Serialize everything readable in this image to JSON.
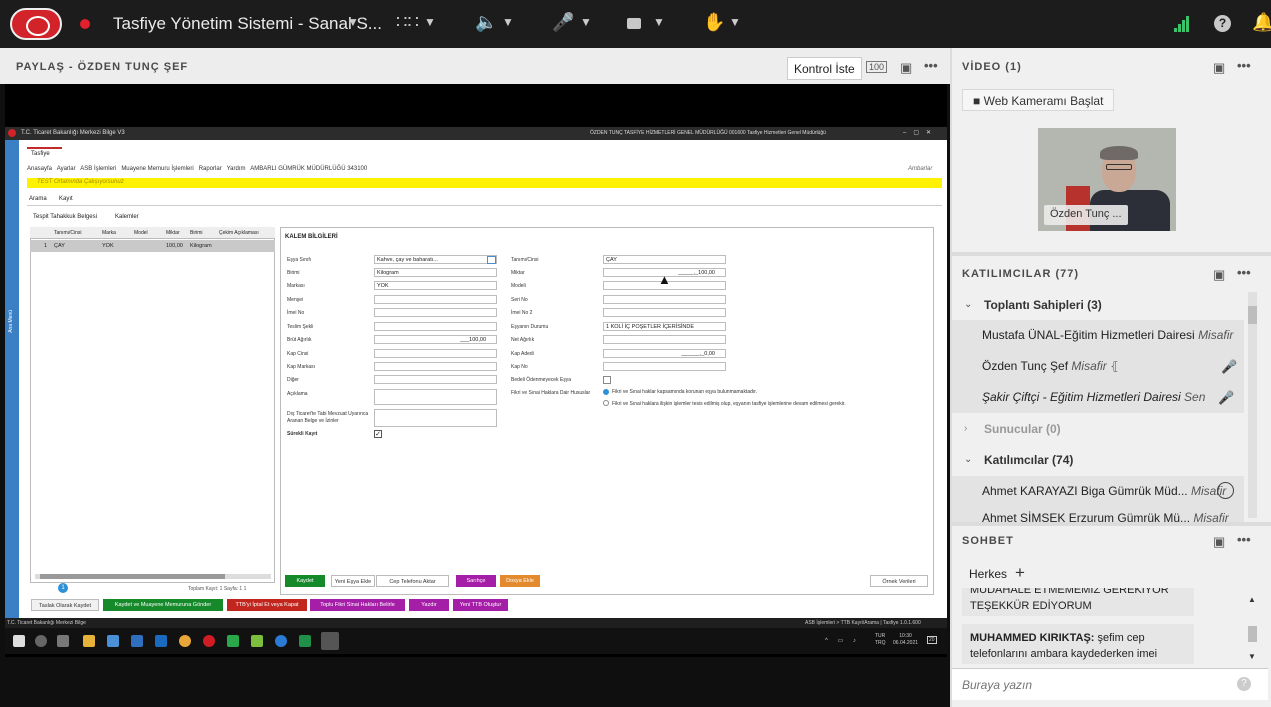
{
  "topbar": {
    "title": "Tasfiye Yönetim Sistemi - Sanal S..."
  },
  "share": {
    "label": "PAYLAŞ  - ÖZDEN TUNÇ ŞEF",
    "control_button": "Kontrol İste",
    "zoom_icon_label": "100"
  },
  "app": {
    "title": "T.C. Ticaret Bakanlığı   Merkezi Bilge V3",
    "title_right": "ÖZDEN TUNÇ   TASFİYE HİZMETLERİ GENEL MÜDÜRLÜĞÜ 001600   Tasfiye Hizmetleri Genel Müdürlüğü",
    "tab": "Tasfiye",
    "menu": [
      "Anasayfa",
      "Ayarlar",
      "ASB İşlemleri",
      "Muayene Memuru İşlemleri",
      "Raporlar",
      "Yardım",
      "AMBARLI GÜMRÜK MÜDÜRLÜĞÜ 343100"
    ],
    "menu_right": "Ambarlar",
    "warning": "TEST Ortamında Çalışıyorsunuz",
    "subtabs": [
      "Arama",
      "Kayıt"
    ],
    "subtabs2": [
      "Tespit Tahakkuk Belgesi",
      "Kalemler"
    ],
    "left_strip": "Ana Menü",
    "grid": {
      "headers": [
        "Tanımı/Cinsi",
        "Marka",
        "Model",
        "Miktar",
        "Birimi",
        "Çekim Açıklaması"
      ],
      "row": [
        "1",
        "ÇAY",
        "YOK",
        "",
        "100,00",
        "Kilogram",
        ""
      ]
    },
    "pager": {
      "page": "1",
      "info": "Toplam Kayıt:  1    Sayfa:  1   1"
    },
    "section_title": "KALEM BİLGİLERİ",
    "form_left": [
      {
        "label": "Eşya Sınıfı",
        "value": "Kahve, çay ve baharatı..."
      },
      {
        "label": "Birimi",
        "value": "Kilogram"
      },
      {
        "label": "Markası",
        "value": "YOK"
      },
      {
        "label": "Menşei",
        "value": ""
      },
      {
        "label": "İmei No",
        "value": ""
      },
      {
        "label": "Teslim Şekli",
        "value": ""
      },
      {
        "label": "Brüt Ağırlık",
        "value": "___100,00"
      },
      {
        "label": "Kap Cinsi",
        "value": ""
      },
      {
        "label": "Kap Markası",
        "value": ""
      },
      {
        "label": "Diğer",
        "value": ""
      },
      {
        "label": "Açıklama",
        "value": ""
      },
      {
        "label": "Dış Ticaret'te Tabi Mevzuat Uyarınca Aranan Belge ve İzinler",
        "value": ""
      }
    ],
    "form_right": [
      {
        "label": "Tanımı/Cinsi",
        "value": "ÇAY"
      },
      {
        "label": "Miktar",
        "value": "_____,_100,00"
      },
      {
        "label": "Modeli",
        "value": ""
      },
      {
        "label": "Seri No",
        "value": ""
      },
      {
        "label": "İmei No 2",
        "value": ""
      },
      {
        "label": "Eşyanın Durumu",
        "value": "1 KOLİ İÇ POŞETLER İÇERİSİNDE"
      },
      {
        "label": "Net Ağırlık",
        "value": ""
      },
      {
        "label": "Kap Adedi",
        "value": "______,_0,00"
      },
      {
        "label": "Kap No",
        "value": ""
      },
      {
        "label": "Bedeli Ödenmeyecek Eşya",
        "value": ""
      }
    ],
    "surekli": "Sürekli Kayıt",
    "fikri_label": "Fikri ve Sınai Haklara Dair Hususlar",
    "fikri_opt1": "Fikri ve Sınai haklar kapsamında korunan eşya bulunmamaktadır.",
    "fikri_opt2": "Fikri ve Sınai haklara ilişkin işlemler tesis edilmiş olup, eşyanın tasfiye işlemlerine devam edilmesi gerekir.",
    "form_buttons": [
      "Kaydet",
      "Yeni Eşya Ekle",
      "Cep Telefonu Aktar",
      "Sarıhçe",
      "Dosya Ekle",
      "Örnek Verileri"
    ],
    "bottom_buttons": [
      "Taslak Olarak Kaydet",
      "Kaydet ve Muayene Memuruna Gönder",
      "TTB'yi İptal Et veya Kapat",
      "Toplu Fikri Sinai Hakları Belirle",
      "Yazdır",
      "Yeni TTB Oluştur"
    ],
    "status_left": "T.C. Ticaret Bakanlığı   Merkezi Bilge",
    "status_right": "ASB İşlemleri  > TTB Kayıt/Arama  |  Tasfiye   1.0.1.600",
    "clock": {
      "lang": "TUR",
      "lang2": "TRQ",
      "time": "10:30",
      "date": "06.04.2021",
      "notif": "20"
    }
  },
  "video": {
    "label": "VİDEO (1)",
    "webcam_button": "Web Kameramı Başlat",
    "name": "Özden Tunç ..."
  },
  "participants": {
    "label": "KATILIMCILAR  (77)",
    "groups": [
      {
        "name": "Toplantı Sahipleri (3)"
      },
      {
        "name": "Sunucular (0)"
      },
      {
        "name": "Katılımcılar (74)"
      }
    ],
    "hosts": [
      {
        "name": "Mustafa ÜNAL-Eğitim Hizmetleri Dairesi",
        "role": "Misafir"
      },
      {
        "name": "Özden Tunç Şef",
        "role": "Misafir"
      },
      {
        "name": "Şakir Çiftçi - Eğitim Hizmetleri Dairesi",
        "role": "Sen"
      }
    ],
    "attendees": [
      {
        "name": "Ahmet KARAYAZI Biga Gümrük Müd...",
        "role": "Misafir"
      },
      {
        "name": "Ahmet ŞİMŞEK Erzurum Gümrük Mü...",
        "role": "Misafir"
      }
    ]
  },
  "chat": {
    "label": "SOHBET",
    "tab": "Herkes",
    "messages": [
      {
        "author": "",
        "text": "MUDAHALE ETMEMEMİZ GEREKİYOR TEŞEKKÜR EDİYORUM"
      },
      {
        "author": "MUHAMMED KIRIKTAŞ:",
        "text": " şefim cep telefonlarını ambara kaydederken imei"
      }
    ],
    "placeholder": "Buraya yazın"
  }
}
